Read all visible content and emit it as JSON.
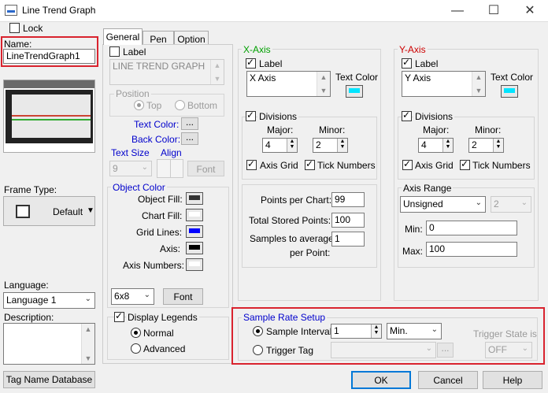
{
  "window": {
    "title": "Line Trend Graph",
    "min_glyph": "—",
    "max_glyph": "☐",
    "close_glyph": "✕"
  },
  "left": {
    "lock_label": "Lock",
    "name_label": "Name:",
    "name_value": "LineTrendGraph1",
    "frame_type_label": "Frame Type:",
    "frame_type_value": "Default",
    "language_label": "Language:",
    "language_value": "Language 1",
    "description_label": "Description:",
    "tag_db_button": "Tag Name Database"
  },
  "tabs": [
    "General",
    "Pen",
    "Option"
  ],
  "general": {
    "label_checkbox": "Label",
    "label_text": "LINE TREND GRAPH",
    "position_title": "Position",
    "pos_top": "Top",
    "pos_bottom": "Bottom",
    "text_color": "Text Color:",
    "back_color": "Back Color:",
    "text_size": "Text Size",
    "align": "Align",
    "text_size_value": "9",
    "font_button": "Font",
    "ellipsis": "...",
    "object_color_title": "Object Color",
    "object_fill": "Object Fill:",
    "chart_fill": "Chart Fill:",
    "grid_lines": "Grid Lines:",
    "axis": "Axis:",
    "axis_numbers": "Axis Numbers:",
    "font_size_value": "6x8",
    "font_button2": "Font",
    "display_legends": "Display Legends",
    "normal": "Normal",
    "advanced": "Advanced"
  },
  "xaxis": {
    "title": "X-Axis",
    "label_checkbox": "Label",
    "label_value": "X Axis",
    "text_color": "Text Color",
    "divisions": "Divisions",
    "major": "Major:",
    "minor": "Minor:",
    "major_value": "4",
    "minor_value": "2",
    "axis_grid": "Axis Grid",
    "tick_numbers": "Tick Numbers",
    "points_per_chart": "Points per Chart:",
    "points_per_chart_value": "99",
    "total_stored": "Total Stored Points:",
    "total_stored_value": "100",
    "samples_avg_1": "Samples to average",
    "samples_avg_2": "per Point:",
    "samples_avg_value": "1"
  },
  "yaxis": {
    "title": "Y-Axis",
    "label_checkbox": "Label",
    "label_value": "Y Axis",
    "text_color": "Text Color",
    "divisions": "Divisions",
    "major": "Major:",
    "minor": "Minor:",
    "major_value": "4",
    "minor_value": "2",
    "axis_grid": "Axis Grid",
    "tick_numbers": "Tick Numbers",
    "axis_range": "Axis Range",
    "range_type": "Unsigned",
    "range_extra": "2",
    "min_label": "Min:",
    "min_value": "0",
    "max_label": "Max:",
    "max_value": "100"
  },
  "sample": {
    "title": "Sample Rate Setup",
    "sample_interval": "Sample Interval",
    "interval_value": "1",
    "interval_unit": "Min.",
    "trigger_tag": "Trigger Tag",
    "trigger_state": "Trigger State is",
    "trigger_state_value": "OFF",
    "ellipsis": "..."
  },
  "footer": {
    "ok": "OK",
    "cancel": "Cancel",
    "help": "Help"
  },
  "colors": {
    "object_fill": "#333333",
    "chart_fill": "#ffffff",
    "grid_lines": "#0000ff",
    "axis": "#000000",
    "axis_numbers": "#ffffff",
    "x_text_color": "#00e5ff",
    "y_text_color": "#00e5ff",
    "highlight": "#d9232e"
  }
}
